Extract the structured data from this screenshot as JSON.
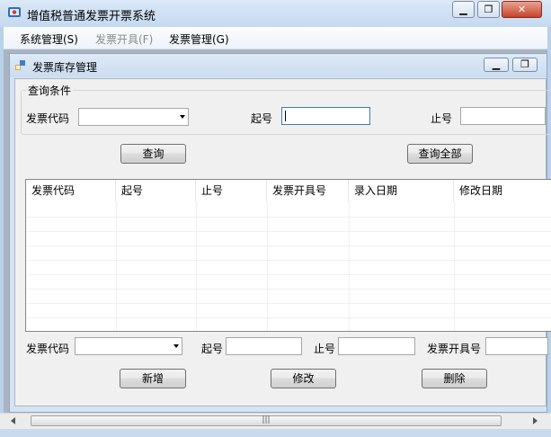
{
  "window": {
    "title": "增值税普通发票开票系统",
    "minimize_glyph": "▁",
    "restore_glyph": "❐",
    "close_glyph": "✕"
  },
  "menu": [
    {
      "label": "系统管理(S)",
      "enabled": true
    },
    {
      "label": "发票开具(F)",
      "enabled": false
    },
    {
      "label": "发票管理(G)",
      "enabled": true
    }
  ],
  "child": {
    "title": "发票库存管理",
    "minimize_glyph": "▁",
    "restore_glyph": "❐"
  },
  "query": {
    "group_label": "查询条件",
    "code_label": "发票代码",
    "code_value": "",
    "start_label": "起号",
    "start_value": "",
    "end_label": "止号",
    "end_value": "",
    "query_button": "查询",
    "query_all_button": "查询全部"
  },
  "table": {
    "columns": [
      "发票代码",
      "起号",
      "止号",
      "发票开具号",
      "录入日期",
      "修改日期"
    ],
    "rows": []
  },
  "edit": {
    "code_label": "发票代码",
    "code_value": "",
    "start_label": "起号",
    "start_value": "",
    "end_label": "止号",
    "end_value": "",
    "issue_label": "发票开具号",
    "issue_value": "",
    "add_button": "新增",
    "modify_button": "修改",
    "delete_button": "删除"
  },
  "scrollbar": {
    "grip_glyph": "|||"
  },
  "colors": {
    "title_gradient_top": "#dbe8f7",
    "client_bg": "#f0f0f0",
    "close_button": "#c7432b",
    "focus_border": "#3c7fb1"
  }
}
